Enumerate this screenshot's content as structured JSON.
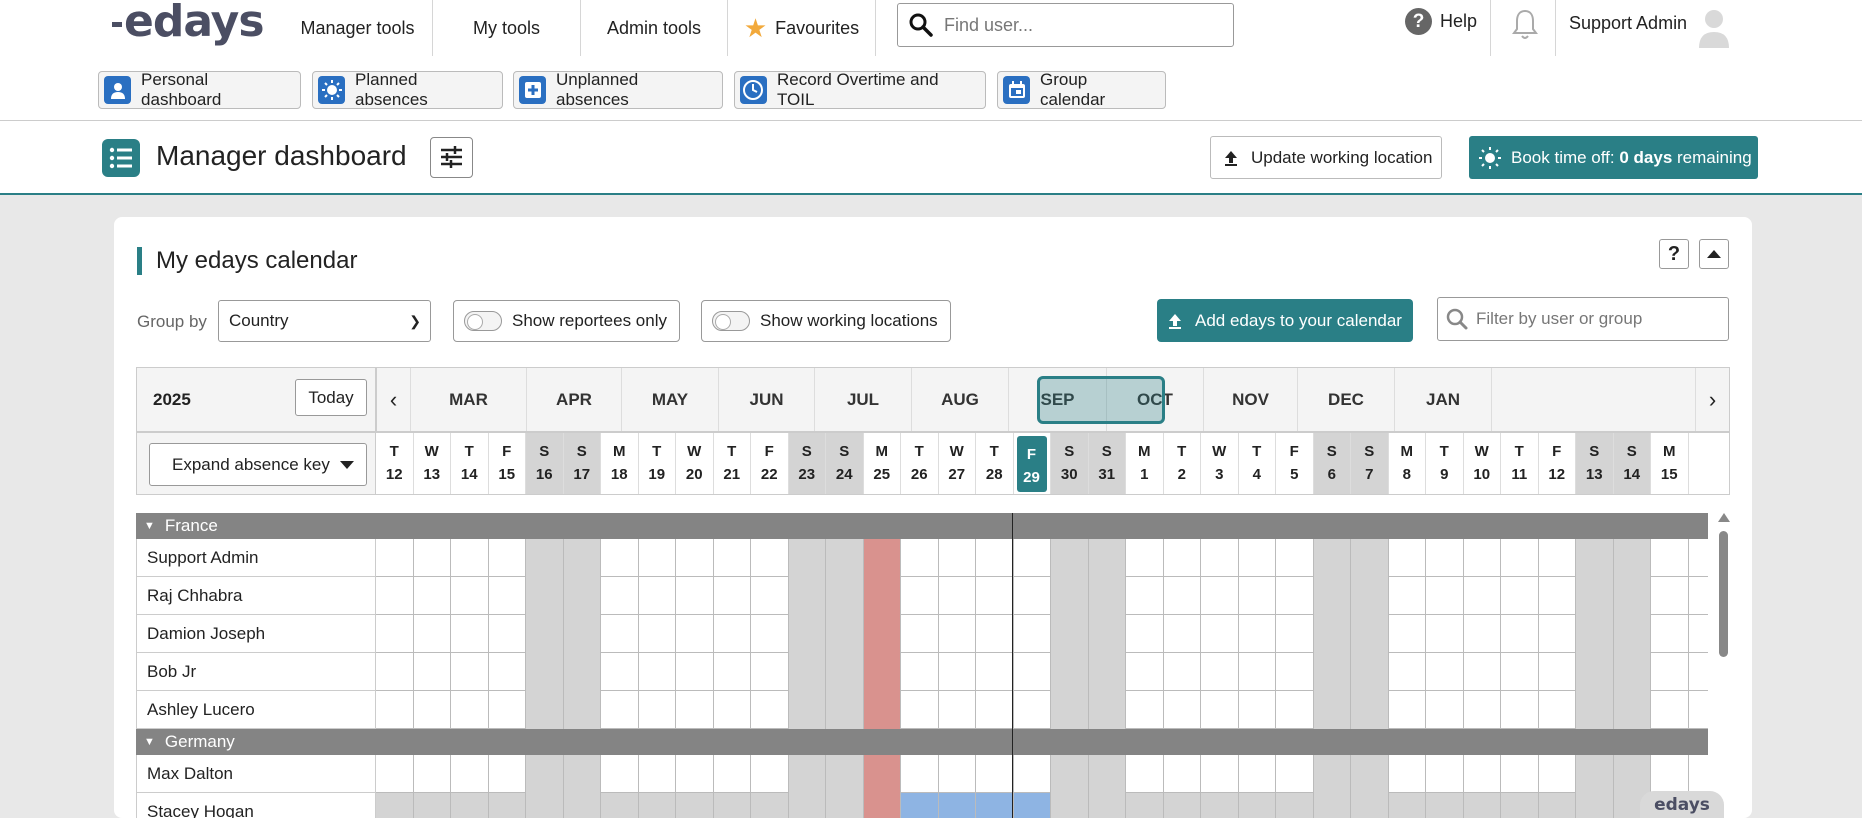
{
  "brand": {
    "logo": "edays",
    "accent": "#2a7f86"
  },
  "nav": {
    "manager_tools": "Manager tools",
    "my_tools": "My tools",
    "admin_tools": "Admin tools",
    "favourites": "Favourites",
    "search_placeholder": "Find user...",
    "help": "Help",
    "user_name": "Support Admin"
  },
  "quick_links": [
    {
      "label": "Personal dashboard",
      "icon": "person-icon"
    },
    {
      "label": "Planned absences",
      "icon": "sun-icon"
    },
    {
      "label": "Unplanned absences",
      "icon": "plus-icon"
    },
    {
      "label": "Record Overtime and TOIL",
      "icon": "clock-icon"
    },
    {
      "label": "Group calendar",
      "icon": "calendar-icon"
    }
  ],
  "header": {
    "title": "Manager dashboard",
    "update_location": "Update working location",
    "book_prefix": "Book time off: ",
    "book_days": "0 days",
    "book_suffix": " remaining"
  },
  "calendar_card": {
    "title": "My edays calendar",
    "help_button": "?",
    "group_by_label": "Group by",
    "group_by_value": "Country",
    "show_reportees": "Show reportees only",
    "show_locations": "Show working locations",
    "add_button": "Add edays to your calendar",
    "filter_placeholder": "Filter by user or group",
    "year": "2025",
    "today_button": "Today",
    "expand_key": "Expand absence key",
    "months": [
      "MAR",
      "APR",
      "MAY",
      "JUN",
      "JUL",
      "AUG",
      "SEP",
      "OCT",
      "NOV",
      "DEC",
      "JAN"
    ],
    "days": [
      {
        "l": "T",
        "n": "12"
      },
      {
        "l": "W",
        "n": "13"
      },
      {
        "l": "T",
        "n": "14"
      },
      {
        "l": "F",
        "n": "15"
      },
      {
        "l": "S",
        "n": "16",
        "we": true
      },
      {
        "l": "S",
        "n": "17",
        "we": true
      },
      {
        "l": "M",
        "n": "18"
      },
      {
        "l": "T",
        "n": "19"
      },
      {
        "l": "W",
        "n": "20"
      },
      {
        "l": "T",
        "n": "21"
      },
      {
        "l": "F",
        "n": "22"
      },
      {
        "l": "S",
        "n": "23",
        "we": true
      },
      {
        "l": "S",
        "n": "24",
        "we": true
      },
      {
        "l": "M",
        "n": "25"
      },
      {
        "l": "T",
        "n": "26"
      },
      {
        "l": "W",
        "n": "27"
      },
      {
        "l": "T",
        "n": "28"
      },
      {
        "l": "F",
        "n": "29",
        "today": true
      },
      {
        "l": "S",
        "n": "30",
        "we": true
      },
      {
        "l": "S",
        "n": "31",
        "we": true
      },
      {
        "l": "M",
        "n": "1"
      },
      {
        "l": "T",
        "n": "2"
      },
      {
        "l": "W",
        "n": "3"
      },
      {
        "l": "T",
        "n": "4"
      },
      {
        "l": "F",
        "n": "5"
      },
      {
        "l": "S",
        "n": "6",
        "we": true
      },
      {
        "l": "S",
        "n": "7",
        "we": true
      },
      {
        "l": "M",
        "n": "8"
      },
      {
        "l": "T",
        "n": "9"
      },
      {
        "l": "W",
        "n": "10"
      },
      {
        "l": "T",
        "n": "11"
      },
      {
        "l": "F",
        "n": "12"
      },
      {
        "l": "S",
        "n": "13",
        "we": true
      },
      {
        "l": "S",
        "n": "14",
        "we": true
      },
      {
        "l": "M",
        "n": "15"
      }
    ],
    "groups": [
      {
        "name": "France",
        "members": [
          "Support Admin",
          "Raj Chhabra",
          "Damion Joseph",
          "Bob Jr",
          "Ashley Lucero"
        ]
      },
      {
        "name": "Germany",
        "members": [
          "Max Dalton",
          "Stacey Hogan"
        ]
      }
    ],
    "holiday_color": "#d9928e",
    "absence_color": "#8eb4e3",
    "weekend_color": "#d4d4d4"
  },
  "footer_logo": "edays"
}
